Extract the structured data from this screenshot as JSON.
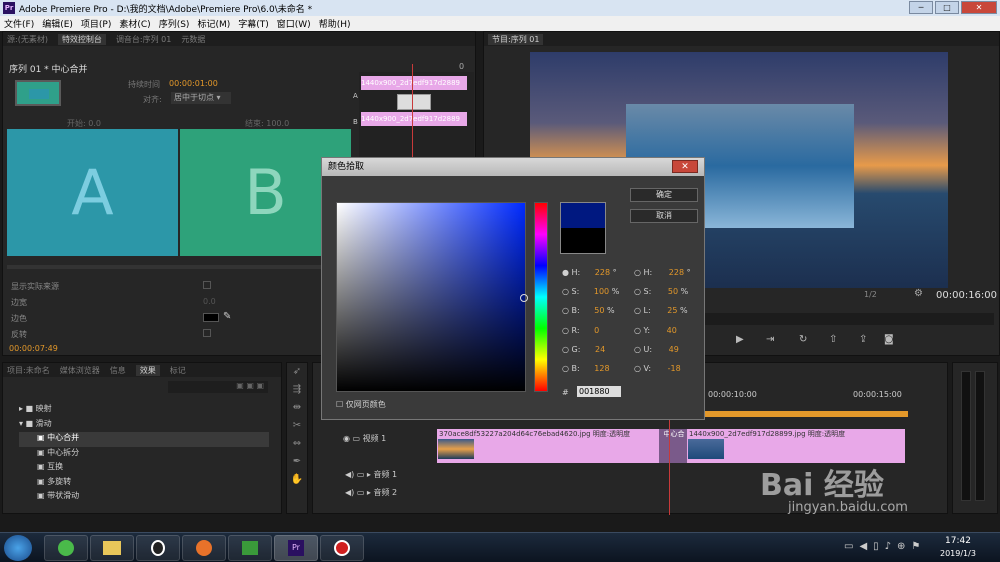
{
  "window": {
    "title": "Adobe Premiere Pro - D:\\我的文档\\Adobe\\Premiere Pro\\6.0\\未命名 *",
    "logo": "Pr",
    "min": "─",
    "max": "□",
    "close": "✕"
  },
  "menu": [
    "文件(F)",
    "编辑(E)",
    "项目(P)",
    "素材(C)",
    "序列(S)",
    "标记(M)",
    "字幕(T)",
    "窗口(W)",
    "帮助(H)"
  ],
  "source_panel": {
    "tabs": [
      "源:(无素材)",
      "特效控制台",
      "调音台:序列 01",
      "元数据"
    ],
    "active_tab": "特效控制台",
    "sequence": "序列 01 * 中心合并",
    "duration_label": "持续时间",
    "duration": "00:00:01:00",
    "align_label": "对齐:",
    "align_value": "居中于切点",
    "start_label": "开始:",
    "start_value": "0.0",
    "end_label": "结束:",
    "end_value": "100.0",
    "a_label": "A",
    "b_label": "B",
    "clip_a": "370ace8df53227a204d64c7",
    "clip_b": "1440x900_2d7edf917d2889",
    "timecode_head": "0",
    "row_labels": [
      "A",
      "B"
    ],
    "options": [
      "显示实际来源",
      "边宽",
      "边色",
      "反转"
    ],
    "border_value": "0.0",
    "timecode": "00:00:07:49"
  },
  "program_panel": {
    "tab": "节目:序列 01",
    "zoom": "1/2",
    "timecode": "00:00:16:00"
  },
  "effects_panel": {
    "tabs": [
      "项目:未命名",
      "媒体浏览器",
      "信息",
      "效果",
      "标记"
    ],
    "active_tab": "效果",
    "items": [
      {
        "label": "映射",
        "type": "folder"
      },
      {
        "label": "滑动",
        "type": "folder"
      },
      {
        "label": "中心合并",
        "type": "effect",
        "selected": true
      },
      {
        "label": "中心拆分",
        "type": "effect"
      },
      {
        "label": "互换",
        "type": "effect"
      },
      {
        "label": "多旋转",
        "type": "effect"
      },
      {
        "label": "带状滑动",
        "type": "effect"
      }
    ]
  },
  "timeline": {
    "ruler": [
      "00:00:10:00",
      "00:00:15:00"
    ],
    "tracks": [
      {
        "label": "视频 1"
      },
      {
        "label": "音频 1"
      },
      {
        "label": "音频 2"
      }
    ],
    "clips": [
      {
        "name": "370ace8df53227a204d64c76ebad4620.jpg",
        "prop": "明度:透明度"
      },
      {
        "name": "1440x900_2d7edf917d28899.jpg",
        "prop": "明度:透明度"
      }
    ],
    "transition": "中心合"
  },
  "color_picker": {
    "title": "颜色拾取",
    "ok": "确定",
    "cancel": "取消",
    "web_only": "仅网页颜色",
    "hex": "001880",
    "hsb": [
      {
        "k": "H:",
        "v": "228",
        "u": "°"
      },
      {
        "k": "S:",
        "v": "100",
        "u": "%"
      },
      {
        "k": "B:",
        "v": "50",
        "u": "%"
      }
    ],
    "rgb": [
      {
        "k": "R:",
        "v": "0"
      },
      {
        "k": "G:",
        "v": "24"
      },
      {
        "k": "B:",
        "v": "128"
      }
    ],
    "hsl": [
      {
        "k": "H:",
        "v": "228",
        "u": "°"
      },
      {
        "k": "S:",
        "v": "50",
        "u": "%"
      },
      {
        "k": "L:",
        "v": "25",
        "u": "%"
      }
    ],
    "yuv": [
      {
        "k": "Y:",
        "v": "40"
      },
      {
        "k": "U:",
        "v": "49"
      },
      {
        "k": "V:",
        "v": "-18"
      }
    ],
    "current_color": "#001880",
    "hash": "#"
  },
  "watermark": {
    "brand": "Bai 经验",
    "url": "jingyan.baidu.com"
  },
  "taskbar": {
    "time": "17:42",
    "date": "2019/1/3"
  },
  "colors": {
    "accent": "#e3982a",
    "clip": "#e8a8e8",
    "tile_a": "#2c97a8",
    "tile_b": "#2ea27a"
  }
}
